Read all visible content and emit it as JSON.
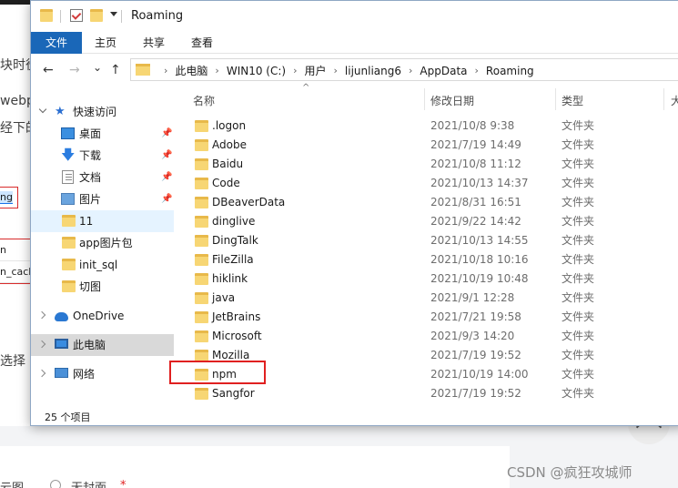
{
  "background": {
    "text_lines": [
      "块时役",
      "webp",
      "经下的",
      "选择",
      "云图",
      "无封面",
      "*"
    ],
    "field_text": "ng",
    "row_texts": [
      "n",
      "n_cach"
    ]
  },
  "watermark": "CSDN @疯狂攻城师",
  "window": {
    "title": "Roaming",
    "ribbon_tabs": [
      "文件",
      "主页",
      "共享",
      "查看"
    ],
    "nav_buttons": {
      "back": "←",
      "forward": "→",
      "recent": "⌄",
      "up": "↑"
    },
    "breadcrumb": [
      "此电脑",
      "WIN10 (C:)",
      "用户",
      "lijunliang6",
      "AppData",
      "Roaming"
    ],
    "breadcrumb_sep": "›"
  },
  "sidebar": {
    "quick_access": "快速访问",
    "pinned": [
      {
        "label": "桌面",
        "icon": "desktop-icon"
      },
      {
        "label": "下载",
        "icon": "download-icon"
      },
      {
        "label": "文档",
        "icon": "document-icon"
      },
      {
        "label": "图片",
        "icon": "picture-icon"
      }
    ],
    "folders": [
      "11",
      "app图片包",
      "init_sql",
      "切图"
    ],
    "onedrive": "OneDrive",
    "this_pc": "此电脑",
    "network": "网络",
    "pin_glyph": "📌"
  },
  "columns": {
    "name": "名称",
    "date": "修改日期",
    "type": "类型",
    "size": "大"
  },
  "files": [
    {
      "name": ".logon",
      "date": "2021/10/8 9:38",
      "type": "文件夹"
    },
    {
      "name": "Adobe",
      "date": "2021/7/19 14:49",
      "type": "文件夹"
    },
    {
      "name": "Baidu",
      "date": "2021/10/8 11:12",
      "type": "文件夹"
    },
    {
      "name": "Code",
      "date": "2021/10/13 14:37",
      "type": "文件夹"
    },
    {
      "name": "DBeaverData",
      "date": "2021/8/31 16:51",
      "type": "文件夹"
    },
    {
      "name": "dinglive",
      "date": "2021/9/22 14:42",
      "type": "文件夹"
    },
    {
      "name": "DingTalk",
      "date": "2021/10/13 14:55",
      "type": "文件夹"
    },
    {
      "name": "FileZilla",
      "date": "2021/10/18 10:16",
      "type": "文件夹"
    },
    {
      "name": "hiklink",
      "date": "2021/10/19 10:48",
      "type": "文件夹"
    },
    {
      "name": "java",
      "date": "2021/9/1 12:28",
      "type": "文件夹"
    },
    {
      "name": "JetBrains",
      "date": "2021/7/21 19:58",
      "type": "文件夹"
    },
    {
      "name": "Microsoft",
      "date": "2021/9/3 14:20",
      "type": "文件夹"
    },
    {
      "name": "Mozilla",
      "date": "2021/7/19 19:52",
      "type": "文件夹"
    },
    {
      "name": "npm",
      "date": "2021/10/19 14:00",
      "type": "文件夹"
    },
    {
      "name": "Sangfor",
      "date": "2021/7/19 19:52",
      "type": "文件夹"
    }
  ],
  "status": {
    "item_count": "25 个项目"
  },
  "colors": {
    "ribbon_active": "#1a67b8",
    "folder": "#f7d674",
    "highlight": "#e02020",
    "selected_nav": "#e5f3ff"
  }
}
